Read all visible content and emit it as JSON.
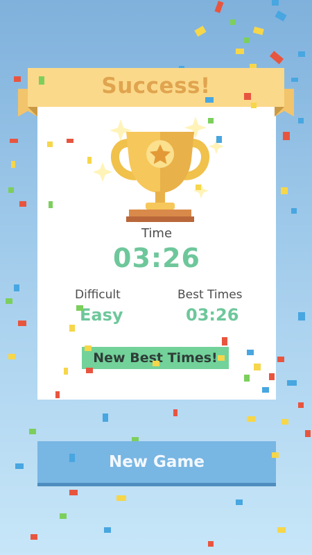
{
  "result": {
    "title": "Success!"
  },
  "stats": {
    "time_label": "Time",
    "time_value": "03:26",
    "difficulty_label": "Difficult",
    "difficulty_value": "Easy",
    "best_label": "Best Times",
    "best_value": "03:26"
  },
  "badge": {
    "text": "New Best Times!"
  },
  "actions": {
    "new_game_label": "New Game"
  },
  "icons": {
    "trophy": "trophy-icon",
    "star": "star-icon",
    "sparkle": "sparkle-icon"
  },
  "colors": {
    "accent_green": "#6ec79b",
    "ribbon": "#fbd98a",
    "ribbon_text": "#e0a44f",
    "button": "#78b6e3",
    "badge": "#72d29a"
  }
}
